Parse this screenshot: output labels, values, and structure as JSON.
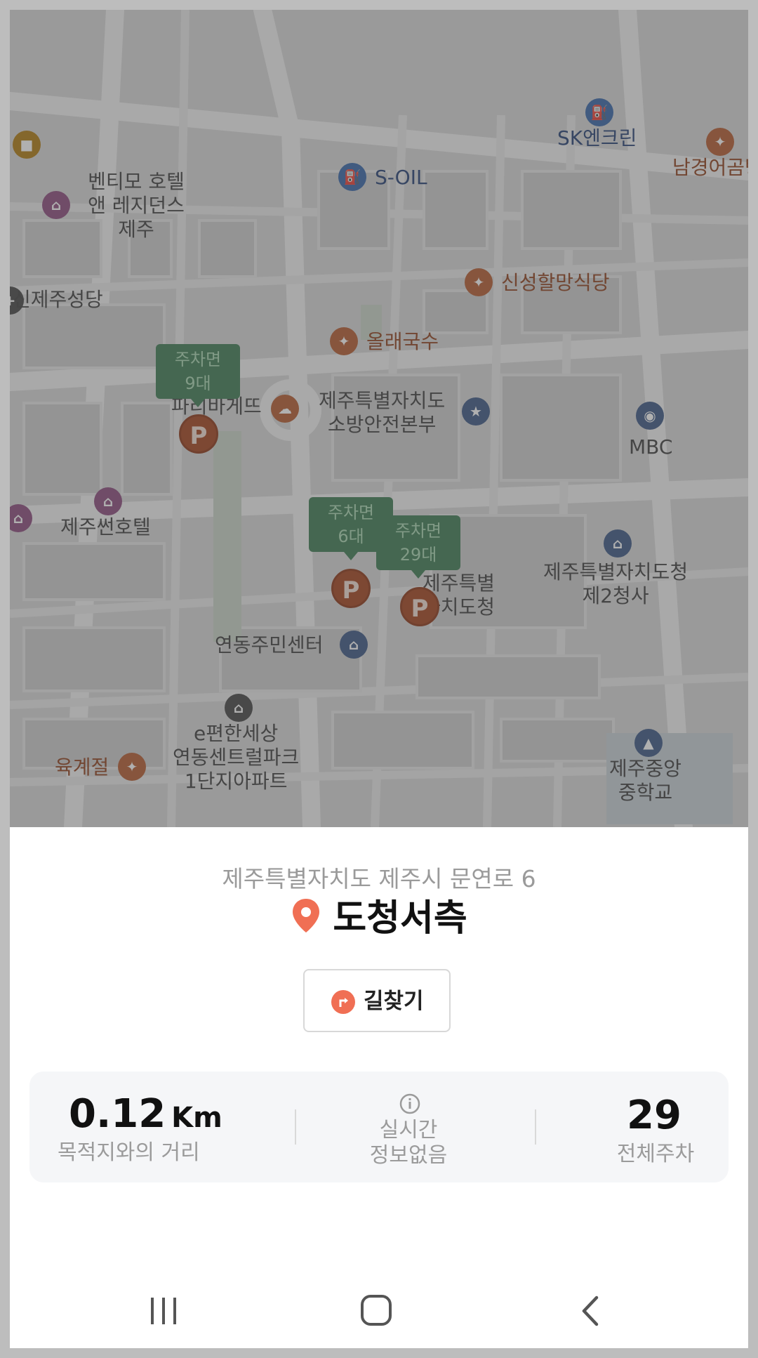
{
  "map": {
    "pois": [
      {
        "label": "벤티모 호텔\n앤 레지던스\n제주",
        "kind": "hotel"
      },
      {
        "label": "S-OIL",
        "kind": "gas"
      },
      {
        "label": "SK엔크린",
        "kind": "gas"
      },
      {
        "label": "남경어곰탕",
        "kind": "restaurant"
      },
      {
        "label": "신제주성당",
        "kind": "church"
      },
      {
        "label": "신성할망식당",
        "kind": "restaurant"
      },
      {
        "label": "올래국수",
        "kind": "restaurant"
      },
      {
        "label": "파리바게뜨",
        "kind": "bakery"
      },
      {
        "label": "제주특별자치도\n소방안전본부",
        "kind": "fire"
      },
      {
        "label": "MBC",
        "kind": "broadcast"
      },
      {
        "label": "제주썬호텔",
        "kind": "hotel"
      },
      {
        "label": "제주특별자치도청\n제2청사",
        "kind": "government"
      },
      {
        "label": "제주특별\n자치도청",
        "kind": "government"
      },
      {
        "label": "연동주민센터",
        "kind": "government"
      },
      {
        "label": "e편한세상\n연동센트럴파크\n1단지아파트",
        "kind": "apartment"
      },
      {
        "label": "육계절",
        "kind": "restaurant"
      },
      {
        "label": "제주중앙\n중학교",
        "kind": "school"
      }
    ],
    "parking_pins": [
      {
        "line1": "주차면",
        "line2": "9대"
      },
      {
        "line1": "주차면",
        "line2": "6대"
      },
      {
        "line1": "주차면",
        "line2": "29대"
      }
    ],
    "parking_symbol": "P"
  },
  "sheet": {
    "address": "제주특별자치도 제주시 문연로 6",
    "place_name": "도청서측",
    "route_button": "길찾기",
    "stats": {
      "distance_value": "0.12",
      "distance_unit": "Km",
      "distance_caption": "목적지와의 거리",
      "realtime_line1": "실시간",
      "realtime_line2": "정보없음",
      "total_value": "29",
      "total_caption": "전체주차"
    }
  },
  "colors": {
    "accent": "#f06f54",
    "parking_green": "#3c7b52",
    "parking_red": "#a3421d"
  },
  "nav": {
    "recents": "recents-icon",
    "home": "home-icon",
    "back": "back-icon"
  }
}
